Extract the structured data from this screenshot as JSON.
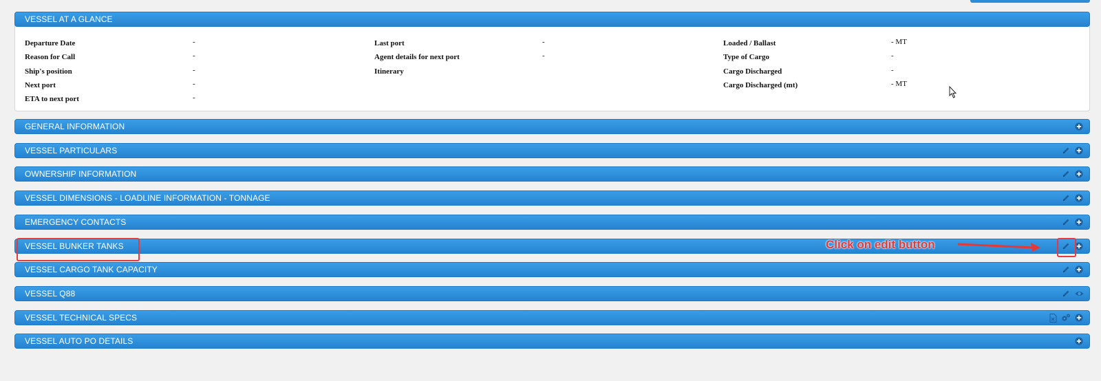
{
  "glance": {
    "title": "VESSEL AT A GLANCE",
    "col1": [
      {
        "label": "Departure Date",
        "value": "-"
      },
      {
        "label": "Reason for Call",
        "value": "-"
      },
      {
        "label": "Ship's position",
        "value": "-"
      },
      {
        "label": "Next port",
        "value": "-"
      },
      {
        "label": "ETA to next port",
        "value": "-"
      }
    ],
    "col2": [
      {
        "label": "Last port",
        "value": "-"
      },
      {
        "label": "Agent details for next port",
        "value": "-"
      },
      {
        "label": "Itinerary",
        "value": ""
      }
    ],
    "col3": [
      {
        "label": "Loaded / Ballast",
        "value": "- MT"
      },
      {
        "label": "Type of Cargo",
        "value": "-"
      },
      {
        "label": "Cargo Discharged",
        "value": "-"
      },
      {
        "label": "Cargo Discharged (mt)",
        "value": "- MT"
      }
    ]
  },
  "sections": [
    {
      "title": "GENERAL INFORMATION",
      "icons": [
        "plus-circle-icon"
      ]
    },
    {
      "title": "VESSEL PARTICULARS",
      "icons": [
        "pencil-icon",
        "plus-circle-icon"
      ]
    },
    {
      "title": "OWNERSHIP INFORMATION",
      "icons": [
        "pencil-icon",
        "plus-circle-icon"
      ]
    },
    {
      "title": "VESSEL DIMENSIONS - LOADLINE INFORMATION - TONNAGE",
      "icons": [
        "pencil-icon",
        "plus-circle-icon"
      ]
    },
    {
      "title": "EMERGENCY CONTACTS",
      "icons": [
        "pencil-icon",
        "plus-circle-icon"
      ]
    },
    {
      "title": "VESSEL BUNKER TANKS",
      "icons": [
        "pencil-icon",
        "plus-circle-icon"
      ]
    },
    {
      "title": "VESSEL CARGO TANK CAPACITY",
      "icons": [
        "pencil-icon",
        "plus-circle-icon"
      ]
    },
    {
      "title": "VESSEL Q88",
      "icons": [
        "pencil-icon",
        "eye-icon"
      ]
    },
    {
      "title": "VESSEL TECHNICAL SPECS",
      "icons": [
        "excel-file-icon",
        "gears-icon",
        "plus-circle-icon"
      ]
    },
    {
      "title": "VESSEL AUTO PO DETAILS",
      "icons": [
        "plus-circle-icon"
      ]
    }
  ],
  "annotation": {
    "callout_text": "Click on edit button",
    "accent_color": "#e8393f"
  },
  "colors": {
    "header_blue": "#2e8bd6",
    "background": "#f1f1f1"
  }
}
